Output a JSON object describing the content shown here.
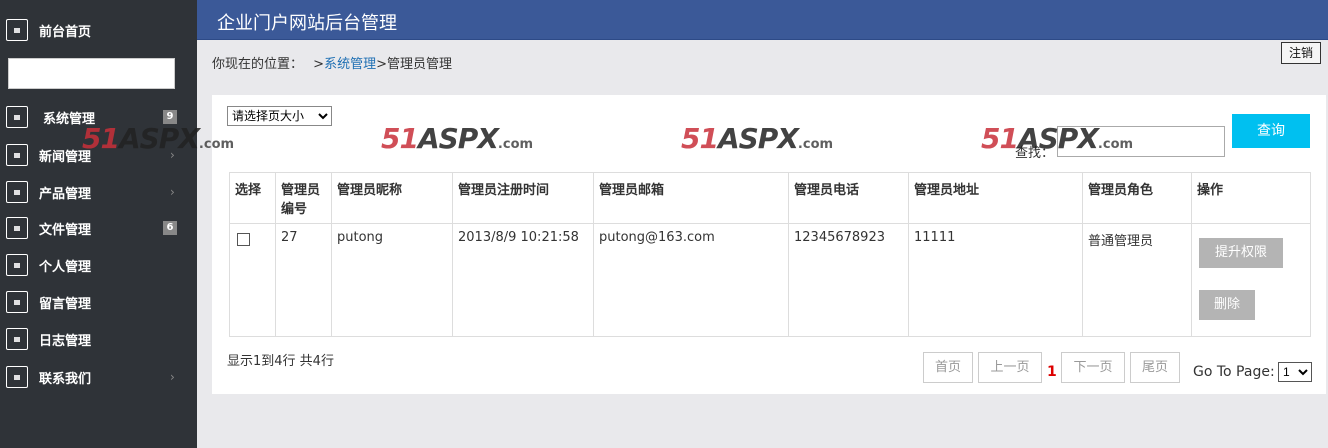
{
  "sidebar": {
    "items": [
      {
        "label": "前台首页",
        "badge": null,
        "chevron": false
      },
      {
        "label": "系统管理",
        "badge": "9",
        "chevron": false
      },
      {
        "label": "新闻管理",
        "badge": null,
        "chevron": true
      },
      {
        "label": "产品管理",
        "badge": null,
        "chevron": true
      },
      {
        "label": "文件管理",
        "badge": "6",
        "chevron": false
      },
      {
        "label": "个人管理",
        "badge": null,
        "chevron": false
      },
      {
        "label": "留言管理",
        "badge": null,
        "chevron": false
      },
      {
        "label": "日志管理",
        "badge": null,
        "chevron": false
      },
      {
        "label": "联系我们",
        "badge": null,
        "chevron": true
      }
    ],
    "search_value": ""
  },
  "header": {
    "title": "企业门户网站后台管理",
    "logout": "注销"
  },
  "breadcrumb": {
    "prefix": "你现在的位置：",
    "sep1": ">",
    "link": "系统管理",
    "sep2": ">",
    "current": "管理员管理"
  },
  "toolbar": {
    "page_size_placeholder": "请选择页大小",
    "watermark_num": "51",
    "watermark_mid": "ASPX",
    "watermark_dom": ".com",
    "find_label": "查找：",
    "find_value": "",
    "query_label": "查询"
  },
  "table": {
    "headers": [
      "选择",
      "管理员编号",
      "管理员昵称",
      "管理员注册时间",
      "管理员邮箱",
      "管理员电话",
      "管理员地址",
      "管理员角色",
      "操作"
    ],
    "rows": [
      {
        "id": "27",
        "nick": "putong",
        "time": "2013/8/9 10:21:58",
        "email": "putong@163.com",
        "phone": "12345678923",
        "addr": "11111",
        "role": "普通管理员"
      }
    ],
    "actions": {
      "promote": "提升权限",
      "delete": "删除"
    }
  },
  "pagination": {
    "info": "显示1到4行 共4行",
    "first": "首页",
    "prev": "上一页",
    "current": "1",
    "next": "下一页",
    "last": "尾页",
    "goto_label": "Go To Page:",
    "goto_value": "1"
  }
}
